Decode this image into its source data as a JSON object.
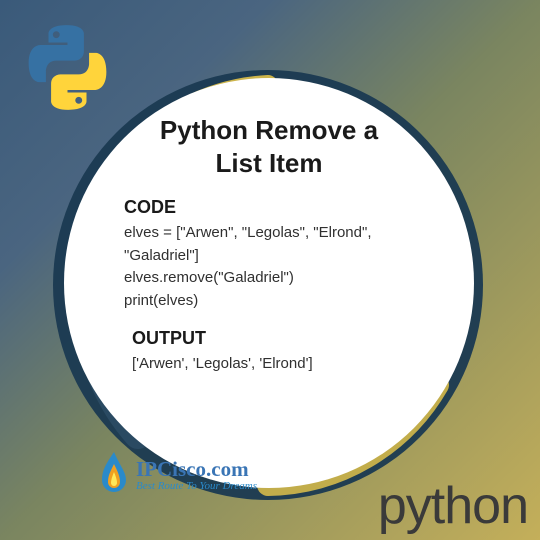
{
  "title_line1": "Python Remove a",
  "title_line2": "List Item",
  "code_label": "CODE",
  "code_line1": "elves = [\"Arwen\", \"Legolas\", \"Elrond\",",
  "code_line2": "\"Galadriel\"]",
  "code_line3": "elves.remove(\"Galadriel\")",
  "code_line4": "print(elves)",
  "output_label": "OUTPUT",
  "output_line": "['Arwen', 'Legolas', 'Elrond']",
  "brand_name": "IPCisco.com",
  "brand_tagline": "Best Route To Your Dreams",
  "footer_word": "python"
}
